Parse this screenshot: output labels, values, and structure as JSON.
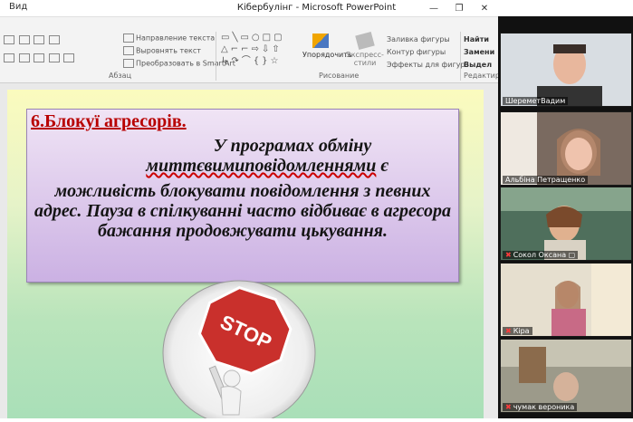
{
  "window": {
    "app_menu_label": "Вид",
    "title": "Кібербулінг - Microsoft PowerPoint",
    "minimize_glyph": "—",
    "restore_glyph": "❐",
    "close_glyph": "✕"
  },
  "ribbon": {
    "paragraph": {
      "text_direction": "Направление текста",
      "align_text": "Выровнять текст",
      "convert_smartart": "Преобразовать в SmartArt",
      "group_label": "Абзац"
    },
    "drawing": {
      "arrange": "Упорядочить",
      "quick_styles": "Экспресс-стили",
      "shape_fill": "Заливка фигуры",
      "shape_outline": "Контур фигуры",
      "shape_effects": "Эффекты для фигур",
      "group_label": "Рисование"
    },
    "editing": {
      "find": "Найти",
      "replace": "Замени",
      "select": "Выдел",
      "group_label": "Редактиро"
    }
  },
  "slide": {
    "heading": "6.Блокуї агресорів.",
    "line1": "У програмах обміну",
    "line2": "миттєвимиповідомленнями",
    "line2_suffix": " є",
    "line3": "можливість блокувати повідомлення з певних адрес. Пауза в спілкуванні часто відбиває в агресора бажання продовжувати цькування.",
    "stop_sign_text": "STOP"
  },
  "participants": [
    {
      "name": "ШереметВадим",
      "muted": false
    },
    {
      "name": "Альбіна Петращенко",
      "muted": false
    },
    {
      "name": "Сокол Оксана",
      "muted": true
    },
    {
      "name": "Кіра",
      "muted": true
    },
    {
      "name": "чумак вероника",
      "muted": true
    }
  ],
  "colors": {
    "heading": "#b80000",
    "textbox_top": "#f0e4f5",
    "textbox_bottom": "#cbb1e3",
    "stop_red": "#c9302c"
  }
}
